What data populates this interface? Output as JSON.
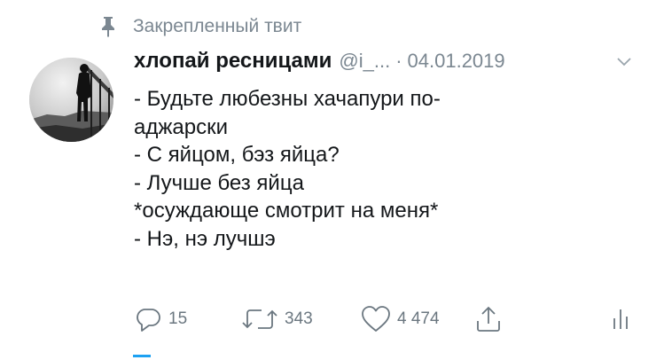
{
  "pinned": {
    "label": "Закрепленный твит",
    "icon": "pin-icon"
  },
  "tweet": {
    "author_name": "хлопай ресницами",
    "handle": "@i_...",
    "separator": "·",
    "date": "04.01.2019",
    "lines": [
      "- Будьте любезны хачапури по-",
      "аджарски",
      "- С яйцом, бэз яйца?",
      "- Лучше без яйца",
      "*осуждающе смотрит на меня*",
      "- Нэ, нэ лучшэ"
    ]
  },
  "actions": {
    "reply": {
      "icon": "reply-icon",
      "count": "15"
    },
    "retweet": {
      "icon": "retweet-icon",
      "count": "343"
    },
    "like": {
      "icon": "heart-icon",
      "count": "4 474"
    },
    "share": {
      "icon": "share-icon"
    },
    "analytics": {
      "icon": "analytics-icon"
    }
  },
  "colors": {
    "text": "#14171a",
    "secondary": "#7b8791",
    "icon": "#6b7780",
    "accent": "#1da1f2"
  }
}
